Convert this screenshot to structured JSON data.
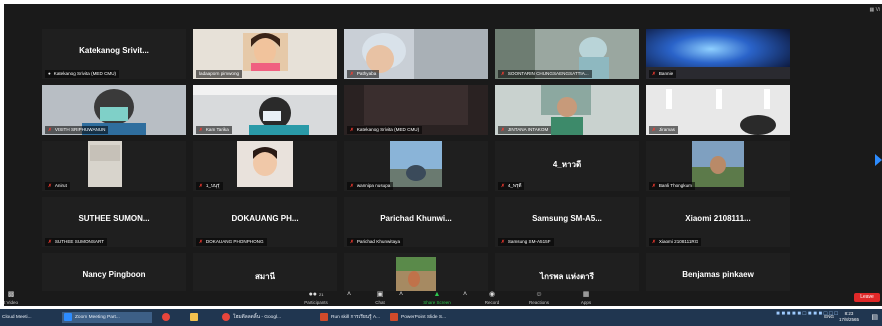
{
  "window": {
    "view_label": "▦ Vi",
    "leave_label": "Leave"
  },
  "tiles": [
    {
      "id": "t1",
      "name": "Katekanog Srivit...",
      "label": "Katekanog Srivita (MED CMU)",
      "mic": "mic-on",
      "video": false
    },
    {
      "id": "t2",
      "name": "",
      "label": "ladaaporn pimwong",
      "mic": "none",
      "video": true,
      "active": true
    },
    {
      "id": "t3",
      "name": "",
      "label": "Pathyaba",
      "mic": "muted",
      "video": true
    },
    {
      "id": "t4",
      "name": "",
      "label": "SOONTARIN CHUNGSAENGSATTIA...",
      "mic": "muted",
      "video": true
    },
    {
      "id": "t5",
      "name": "",
      "label": "Bannie",
      "mic": "muted",
      "video": true
    },
    {
      "id": "t6",
      "name": "",
      "label": "VISITH SRIPHUWANUN",
      "mic": "muted",
      "video": true
    },
    {
      "id": "t7",
      "name": "",
      "label": "Kam Tarika",
      "mic": "muted",
      "video": true
    },
    {
      "id": "t8",
      "name": "",
      "label": "Katekanog Srivita (MED CMU)",
      "mic": "muted",
      "video": true
    },
    {
      "id": "t9",
      "name": "",
      "label": "JINTANA INTAKOM",
      "mic": "muted",
      "video": true
    },
    {
      "id": "t10",
      "name": "",
      "label": "Jiramas",
      "mic": "muted",
      "video": true
    },
    {
      "id": "t11",
      "name": "",
      "label": "Anirut",
      "mic": "muted",
      "video": true
    },
    {
      "id": "t12",
      "name": "",
      "label": "1_บนุรุ่",
      "mic": "muted",
      "video": true
    },
    {
      "id": "t13",
      "name": "",
      "label": "wannipa nusupa",
      "mic": "muted",
      "video": true
    },
    {
      "id": "t14",
      "name": "4_หาวดี",
      "label": "4_พรุดี",
      "mic": "muted",
      "video": false
    },
    {
      "id": "t15",
      "name": "",
      "label": "Banli Thongkum",
      "mic": "muted",
      "video": true
    },
    {
      "id": "t16",
      "name": "SUTHEE SUMON...",
      "label": "SUTHEE SUMONSART",
      "mic": "muted",
      "video": false
    },
    {
      "id": "t17",
      "name": "DOKAUANG PH...",
      "label": "DOKAUANG PHONPHONG",
      "mic": "muted",
      "video": false
    },
    {
      "id": "t18",
      "name": "Parichad Khunwi...",
      "label": "Parichad Khunwitaya",
      "mic": "muted",
      "video": false
    },
    {
      "id": "t19",
      "name": "Samsung SM-A5...",
      "label": "Samsung SM-A515F",
      "mic": "muted",
      "video": false
    },
    {
      "id": "t20",
      "name": "Xiaomi 2108111...",
      "label": "Xiaomi 2108111RG",
      "mic": "muted",
      "video": false
    },
    {
      "id": "t21",
      "name": "Nancy Pingboon",
      "label": "Nancy Pingboon",
      "mic": "muted",
      "video": false
    },
    {
      "id": "t22",
      "name": "สมานี",
      "label": "สมานี",
      "mic": "muted",
      "video": false
    },
    {
      "id": "t23",
      "name": "",
      "label": "Bank Nattawut",
      "mic": "muted",
      "video": true
    },
    {
      "id": "t24",
      "name": "ไกรพล แห่งตารี",
      "label": "ไกรพล สมศรี",
      "mic": "muted",
      "video": false
    },
    {
      "id": "t25",
      "name": "Benjamas pinkaew",
      "label": "Benjamas pinkaew",
      "mic": "muted",
      "video": false
    }
  ],
  "controls": {
    "start_video": "t Video",
    "participants": "Participants",
    "participants_count": "21",
    "chat": "Chat",
    "share_screen": "Share Screen",
    "record": "Record",
    "reactions": "Reactions",
    "apps": "Apps"
  },
  "taskbar": {
    "items": [
      "Cloud Meeti...",
      "Zoom Meeting Part...",
      "",
      "",
      "โฮมดีลลดลิ้น - Googl...",
      "Run skill การเรียนรู้ A...",
      "PowerPoint Slide S..."
    ],
    "lang": "ENG",
    "time": "8:23",
    "date": "17/8/2565"
  },
  "colors": {
    "zoom_bg": "#1a1a1a",
    "tile_bg": "#1f1f1f",
    "active_border": "#9fcf2e",
    "muted": "#ff3b30",
    "leave": "#e02828",
    "share": "#2cc84d",
    "taskbar": "#203650"
  }
}
